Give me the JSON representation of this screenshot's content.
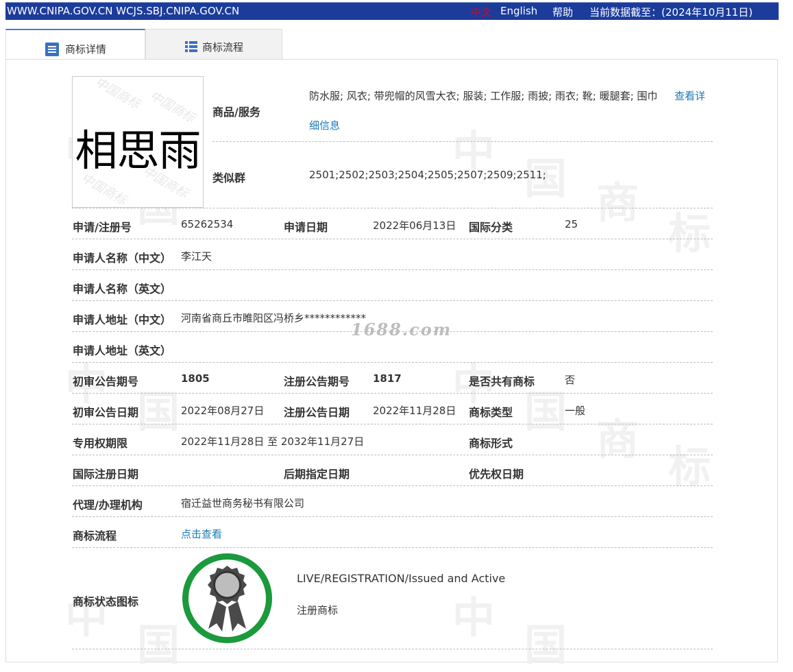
{
  "topbar": {
    "domains": "WWW.CNIPA.GOV.CN WCJS.SBJ.CNIPA.GOV.CN",
    "lang_cn": "中文",
    "lang_en": "English",
    "help": "帮助",
    "as_of": "当前数据截至：(2024年10月11日)"
  },
  "tabs": [
    {
      "label": "商标详情",
      "icon": "list-doc-icon"
    },
    {
      "label": "商标流程",
      "icon": "table-grid-icon"
    }
  ],
  "trademark": {
    "image_text": "相思雨",
    "goods_label": "商品/服务",
    "goods_value": "防水服; 风衣; 带兜帽的风雪大衣; 服装; 工作服; 雨披; 雨衣; 靴; 暖腿套; 围巾",
    "goods_link_1": "查看详",
    "goods_link_2": "细信息",
    "similar_label": "类似群",
    "similar_value": "2501;2502;2503;2504;2505;2507;2509;2511;"
  },
  "fields": {
    "reg_no_label": "申请/注册号",
    "reg_no": "65262534",
    "app_date_label": "申请日期",
    "app_date": "2022年06月13日",
    "intl_class_label": "国际分类",
    "intl_class": "25",
    "applicant_cn_label": "申请人名称（中文）",
    "applicant_cn": "李江天",
    "applicant_en_label": "申请人名称（英文）",
    "address_cn_label": "申请人地址（中文）",
    "address_cn": "河南省商丘市睢阳区冯桥乡************",
    "address_en_label": "申请人地址（英文）",
    "prelim_no_label": "初审公告期号",
    "prelim_no": "1805",
    "reg_pub_no_label": "注册公告期号",
    "reg_pub_no": "1817",
    "shared_label": "是否共有商标",
    "shared": "否",
    "prelim_date_label": "初审公告日期",
    "prelim_date": "2022年08月27日",
    "reg_pub_date_label": "注册公告日期",
    "reg_pub_date": "2022年11月28日",
    "tm_type_label": "商标类型",
    "tm_type": "一般",
    "term_label": "专用权期限",
    "term": "2022年11月28日 至 2032年11月27日",
    "tm_form_label": "商标形式",
    "intl_reg_date_label": "国际注册日期",
    "later_date_label": "后期指定日期",
    "priority_date_label": "优先权日期",
    "agent_label": "代理/办理机构",
    "agent": "宿迁益世商务秘书有限公司",
    "process_label": "商标流程",
    "process_link": "点击查看",
    "status_icon_label": "商标状态图标",
    "status_en": "LIVE/REGISTRATION/Issued and Active",
    "status_cn": "注册商标"
  },
  "watermark": "1688.com",
  "colors": {
    "topbar": "#1c3c9c",
    "link": "#1a7ab8",
    "badge_ring": "#1a9a3c",
    "badge_body": "#4a4a4a"
  }
}
